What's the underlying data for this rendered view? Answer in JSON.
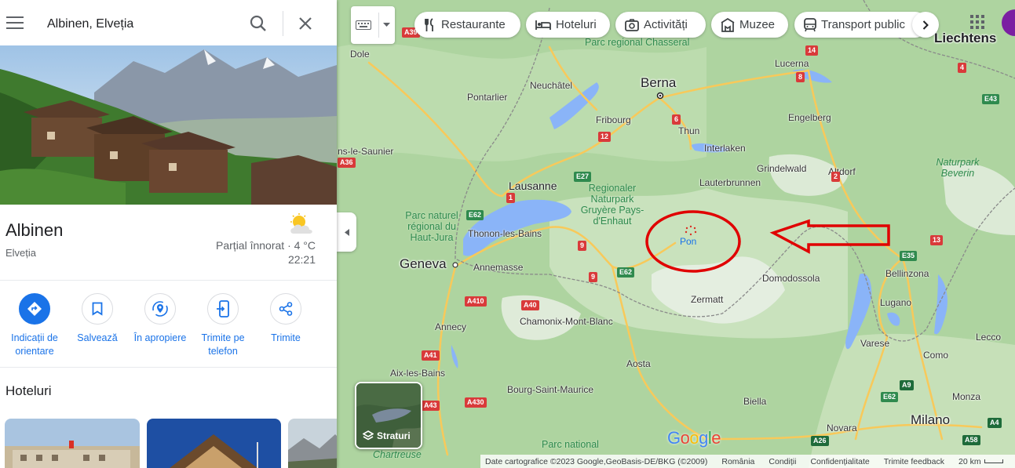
{
  "search": {
    "query": "Albinen, Elveția"
  },
  "place": {
    "name": "Albinen",
    "country": "Elveția",
    "weather_condition": "Parțial înnorat · 4 °C",
    "weather_time": "22:21"
  },
  "actions": [
    {
      "label": "Indicații de orientare",
      "icon": "directions-icon"
    },
    {
      "label": "Salvează",
      "icon": "bookmark-icon"
    },
    {
      "label": "În apropiere",
      "icon": "nearby-icon"
    },
    {
      "label": "Trimite pe telefon",
      "icon": "send-to-phone-icon"
    },
    {
      "label": "Trimite",
      "icon": "share-icon"
    }
  ],
  "hotels": {
    "title": "Hoteluri"
  },
  "chips": [
    {
      "label": "Restaurante",
      "icon": "restaurant-icon"
    },
    {
      "label": "Hoteluri",
      "icon": "hotel-icon"
    },
    {
      "label": "Activități",
      "icon": "camera-icon"
    },
    {
      "label": "Muzee",
      "icon": "museum-icon"
    },
    {
      "label": "Transport public",
      "icon": "transit-icon"
    }
  ],
  "layers": {
    "label": "Straturi"
  },
  "footer": {
    "attribution": "Date cartografice ©2023 Google,GeoBasis-DE/BKG (©2009)",
    "country": "România",
    "terms": "Condiții",
    "privacy": "Confidențialitate",
    "feedback": "Trimite feedback",
    "scale": "20 km"
  },
  "map_labels": {
    "cities_big": [
      "Berna",
      "Geneva",
      "Milano",
      "Liechtens"
    ],
    "cities": [
      "Lucerna",
      "Neuchâtel",
      "Pontarlier",
      "Fribourg",
      "Thun",
      "Interlaken",
      "Engelberg",
      "Grindelwald",
      "Lauterbrunnen",
      "Lausanne",
      "Thonon-les-Bains",
      "Annemasse",
      "Annecy",
      "Chamonix-Mont-Blanc",
      "Zermatt",
      "Domodossola",
      "Bellinzona",
      "Lugano",
      "Varese",
      "Como",
      "Lecco",
      "Aosta",
      "Bourg-Saint-Maurice",
      "Biella",
      "Novara",
      "Monza",
      "Dole",
      "ns-le-Saunier",
      "Aix-les-Bains",
      "Altdorf"
    ],
    "parks": [
      "Parc regional Chasseral",
      "Regionaler Naturpark Gruyère Pays-d'Enhaut",
      "Parc naturel régional du Haut-Jura",
      "Naturpark Beverin",
      "Parc national",
      "Chartreuse"
    ],
    "roads": [
      "A39",
      "A36",
      "E27",
      "E62",
      "E35",
      "E43",
      "A410",
      "A40",
      "A41",
      "A43",
      "A430",
      "A9",
      "A26",
      "A58",
      "A4",
      "1",
      "2",
      "6",
      "9",
      "12",
      "13",
      "14",
      "8",
      "4"
    ],
    "marker_label": "Pon"
  },
  "colors": {
    "accent": "#1a73e8",
    "annotation_red": "#e00000",
    "map_green": "#aed4a0",
    "lake": "#8ab4f8"
  }
}
